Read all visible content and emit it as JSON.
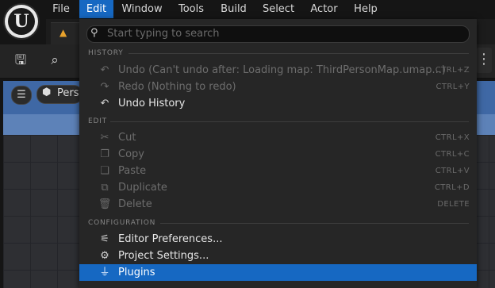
{
  "menubar": {
    "items": [
      {
        "label": "File"
      },
      {
        "label": "Edit"
      },
      {
        "label": "Window"
      },
      {
        "label": "Tools"
      },
      {
        "label": "Build"
      },
      {
        "label": "Select"
      },
      {
        "label": "Actor"
      },
      {
        "label": "Help"
      }
    ],
    "active_item": "Edit",
    "logo_glyph": "U",
    "accent_color": "#1668c2"
  },
  "viewport": {
    "hamburger_glyph": "☰",
    "perspective_label": "Pers"
  },
  "edit_menu": {
    "search_placeholder": "Start typing to search",
    "sections": {
      "history": "HISTORY",
      "edit": "EDIT",
      "configuration": "CONFIGURATION"
    },
    "items": [
      {
        "label": "Undo (Can't undo after: Loading map: ThirdPersonMap.umap...)",
        "shortcut": "CTRL+Z",
        "icon": "undo-icon",
        "enabled": false
      },
      {
        "label": "Redo (Nothing to redo)",
        "shortcut": "CTRL+Y",
        "icon": "redo-icon",
        "enabled": false
      },
      {
        "label": "Undo History",
        "shortcut": "",
        "icon": "undo-history-icon",
        "enabled": true
      },
      {
        "label": "Cut",
        "shortcut": "CTRL+X",
        "icon": "cut-icon",
        "enabled": false
      },
      {
        "label": "Copy",
        "shortcut": "CTRL+C",
        "icon": "copy-icon",
        "enabled": false
      },
      {
        "label": "Paste",
        "shortcut": "CTRL+V",
        "icon": "paste-icon",
        "enabled": false
      },
      {
        "label": "Duplicate",
        "shortcut": "CTRL+D",
        "icon": "duplicate-icon",
        "enabled": false
      },
      {
        "label": "Delete",
        "shortcut": "DELETE",
        "icon": "trash-icon",
        "enabled": false
      },
      {
        "label": "Editor Preferences...",
        "shortcut": "",
        "icon": "sliders-icon",
        "enabled": true
      },
      {
        "label": "Project Settings...",
        "shortcut": "",
        "icon": "gears-icon",
        "enabled": true
      },
      {
        "label": "Plugins",
        "shortcut": "",
        "icon": "plug-icon",
        "enabled": true,
        "highlighted": true
      }
    ]
  }
}
